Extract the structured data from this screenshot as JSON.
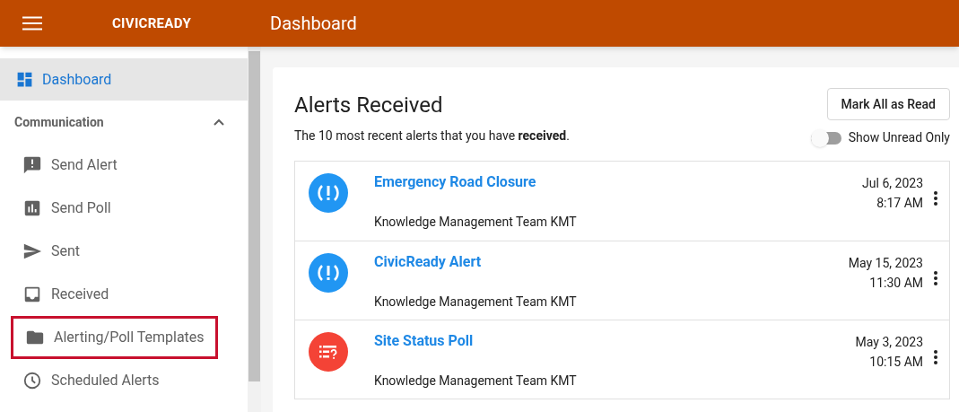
{
  "header": {
    "brand": "CIVICREADY",
    "title": "Dashboard"
  },
  "sidebar": {
    "top_item": {
      "label": "Dashboard",
      "selected": true
    },
    "section": {
      "label": "Communication",
      "expanded": true,
      "items": [
        {
          "label": "Send Alert",
          "kind": "send-alert",
          "highlighted": false
        },
        {
          "label": "Send Poll",
          "kind": "send-poll",
          "highlighted": false
        },
        {
          "label": "Sent",
          "kind": "sent",
          "highlighted": false
        },
        {
          "label": "Received",
          "kind": "received",
          "highlighted": false
        },
        {
          "label": "Alerting/Poll Templates",
          "kind": "templates",
          "highlighted": true
        },
        {
          "label": "Scheduled Alerts",
          "kind": "scheduled",
          "highlighted": false
        }
      ]
    }
  },
  "main": {
    "title": "Alerts Received",
    "subtitle": "The 10 most recent alerts that you have **received**.",
    "mark_all_button": "Mark All as Read",
    "unread_toggle": {
      "label": "Show Unread Only",
      "on": false
    },
    "alerts": [
      {
        "kind": "alert",
        "title": "Emergency Road Closure",
        "sender": "Knowledge Management Team KMT",
        "date": "Jul 6, 2023",
        "time": "8:17 AM"
      },
      {
        "kind": "alert",
        "title": "CivicReady Alert",
        "sender": "Knowledge Management Team KMT",
        "date": "May 15, 2023",
        "time": "11:30 AM"
      },
      {
        "kind": "poll",
        "title": "Site Status Poll",
        "sender": "Knowledge Management Team KMT",
        "date": "May 3, 2023",
        "time": "10:15 AM"
      }
    ]
  }
}
